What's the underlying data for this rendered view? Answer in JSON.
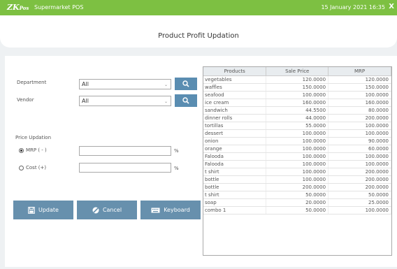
{
  "app": {
    "brand_main": "ZK",
    "brand_sub": "Pos",
    "title": "Supermarket POS",
    "datetime": "15 January 2021 16:35",
    "close": "X"
  },
  "page": {
    "title": "Product Profit Updation"
  },
  "filters": {
    "department_label": "Department",
    "department_value": "All",
    "vendor_label": "Vendor",
    "vendor_value": "All"
  },
  "price_updation": {
    "heading": "Price Updation",
    "mrp_label": "MRP ( - )",
    "cost_label": "Cost (+)",
    "mrp_value": "",
    "cost_value": "",
    "percent_symbol": "%",
    "selected": "mrp"
  },
  "buttons": {
    "update": "Update",
    "cancel": "Cancel",
    "keyboard": "Keyboard"
  },
  "table": {
    "headers": [
      "Products",
      "Sale Price",
      "MRP"
    ],
    "rows": [
      [
        "vegetables",
        "120.0000",
        "120.0000"
      ],
      [
        "waffles",
        "150.0000",
        "150.0000"
      ],
      [
        "seafood",
        "100.0000",
        "100.0000"
      ],
      [
        "ice cream",
        "160.0000",
        "160.0000"
      ],
      [
        "sandwich",
        "44.5500",
        "80.0000"
      ],
      [
        "dinner rolls",
        "44.0000",
        "200.0000"
      ],
      [
        "tortillas",
        "55.0000",
        "100.0000"
      ],
      [
        "dessert",
        "100.0000",
        "100.0000"
      ],
      [
        "onion",
        "100.0000",
        "90.0000"
      ],
      [
        "orange",
        "100.0000",
        "60.0000"
      ],
      [
        "Falooda",
        "100.0000",
        "100.0000"
      ],
      [
        "Falooda",
        "100.0000",
        "100.0000"
      ],
      [
        "t shirt",
        "100.0000",
        "200.0000"
      ],
      [
        "bottle",
        "100.0000",
        "200.0000"
      ],
      [
        "bottle",
        "200.0000",
        "200.0000"
      ],
      [
        "t shirt",
        "50.0000",
        "50.0000"
      ],
      [
        "soap",
        "20.0000",
        "25.0000"
      ],
      [
        "combo 1",
        "50.0000",
        "100.0000"
      ]
    ]
  },
  "colors": {
    "topbar": "#7dc042",
    "button": "#6790ad",
    "search_button": "#5a8db1"
  },
  "icons": {
    "search": "search-icon",
    "save": "save-icon",
    "cancel": "cancel-icon",
    "keyboard": "keyboard-icon",
    "close": "close-icon",
    "dropdown": "chevron-down-icon"
  }
}
